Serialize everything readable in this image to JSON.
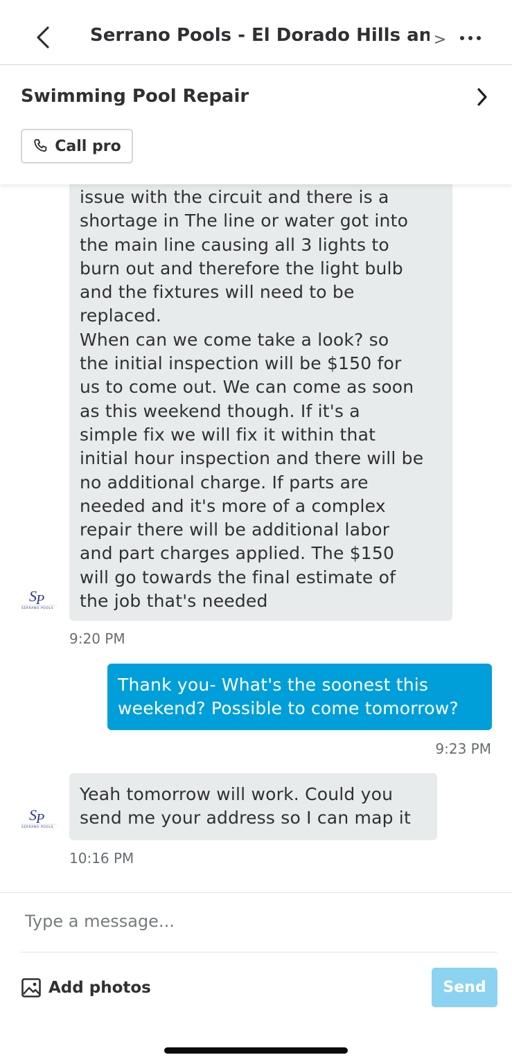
{
  "header": {
    "title": "Serrano Pools - El Dorado Hills and...",
    "title_chevron": ">",
    "back_icon": "chevron-left-icon",
    "more_icon": "more-horizontal-icon"
  },
  "service": {
    "title": "Swimming Pool Repair",
    "chevron_icon": "chevron-right-icon",
    "call_label": "Call pro",
    "call_icon": "phone-icon"
  },
  "avatar": {
    "monogram": "SP",
    "brand": "SERRANO POOLS"
  },
  "messages": [
    {
      "direction": "incoming",
      "text": "issue with the circuit and there is a\nshortage  in The line or water got into\nthe main line causing all 3 lights to\nburn out and therefore the light bulb\nand the fixtures will need to be\nreplaced.\nWhen can we come take a look? so\nthe initial inspection will be $150 for\nus to come out. We can come as soon\nas this weekend though. If it's a\nsimple fix we will fix it within that\ninitial hour inspection and there will be\nno additional charge. If parts are\nneeded and it's more of a complex\nrepair there will be additional labor\nand part charges applied. The $150\nwill go towards the final estimate of\nthe job that's needed",
      "time": "9:20 PM"
    },
    {
      "direction": "outgoing",
      "text": "Thank you-  What's the soonest this\nweekend? Possible to come tomorrow?",
      "time": "9:23 PM"
    },
    {
      "direction": "incoming",
      "text": "Yeah tomorrow will work. Could you\nsend me your address so I can map it",
      "time": "10:16 PM"
    }
  ],
  "composer": {
    "placeholder": "Type a message...",
    "add_photos_label": "Add photos",
    "add_photos_icon": "image-icon",
    "send_label": "Send"
  },
  "colors": {
    "outgoing_bubble": "#009fd9",
    "incoming_bubble": "#e8ebec",
    "send_button_disabled": "#8bd3f1",
    "text_primary": "#2f3033"
  }
}
